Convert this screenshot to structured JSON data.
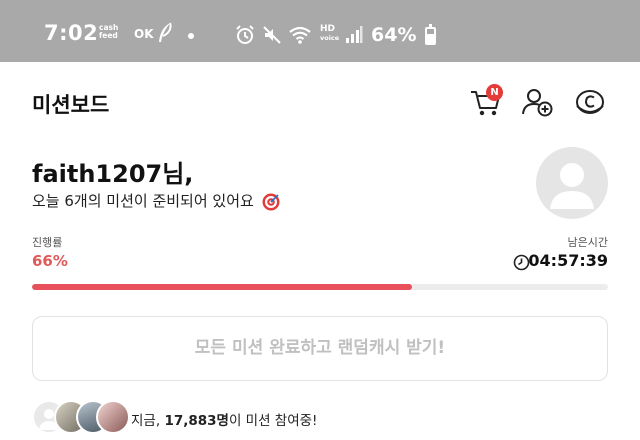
{
  "status_bar": {
    "time": "7:02",
    "cashfeed_line1": "cash",
    "cashfeed_line2": "feed",
    "ok_label": "OK",
    "hd_label": "HD",
    "voice_label": "voice",
    "battery_pct": "64%",
    "battery_level": 0.64,
    "icons": [
      "feather-icon",
      "dot-icon",
      "alarm-icon",
      "mute-icon",
      "wifi-icon",
      "signal-icon",
      "battery-icon"
    ]
  },
  "header": {
    "title": "미션보드",
    "cart_badge": "N",
    "icons": [
      "cart-icon",
      "add-friend-icon",
      "coin-icon"
    ]
  },
  "greeting": {
    "name": "faith1207님,",
    "subtitle": "오늘 6개의 미션이 준비되어 있어요"
  },
  "progress": {
    "label": "진행률",
    "percent_text": "66%",
    "value": 0.66,
    "remaining_label": "남은시간",
    "remaining_time": "04:57:39"
  },
  "cta": {
    "label": "모든 미션 완료하고 랜덤캐시 받기!"
  },
  "participants": {
    "prefix": "지금, ",
    "count": "17,883명",
    "suffix": "이 미션 참여중!"
  },
  "colors": {
    "accent": "#e8505b",
    "status_bar_bg": "#a9a9a9",
    "badge": "#e43a3a"
  }
}
